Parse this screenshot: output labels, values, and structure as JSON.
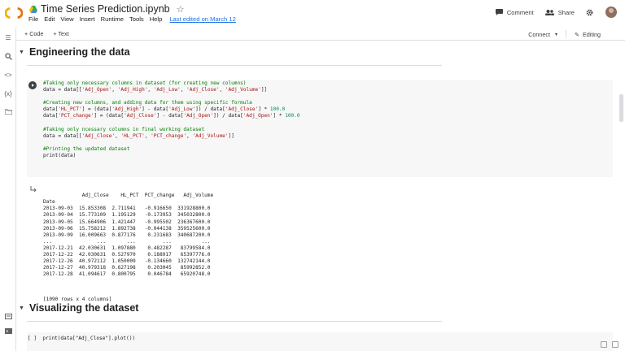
{
  "header": {
    "doc_title": "Time Series Prediction.ipynb",
    "menu": [
      "File",
      "Edit",
      "View",
      "Insert",
      "Runtime",
      "Tools",
      "Help"
    ],
    "last_edited": "Last edited on March 12",
    "comment_label": "Comment",
    "share_label": "Share"
  },
  "toolbar": {
    "code_label": "+ Code",
    "text_label": "+ Text",
    "connect_label": "Connect",
    "editing_label": "Editing"
  },
  "sections": {
    "engineering": "Engineering the data",
    "visualizing": "Visualizing the dataset"
  },
  "cell": {
    "code_lines": [
      "#Taking only necessary columns in dataset (for creating new columns)",
      "data = data[['Adj_Open', 'Adj_High', 'Adj_Low', 'Adj_Close', 'Adj_Volume']]",
      "",
      "#Creating new columns, and adding data for them using specific formula",
      "data['HL_PCT'] = (data['Adj_High'] - data['Adj_Low']) / data['Adj_Close'] * 100.0",
      "data['PCT_change'] = (data['Adj_Close'] - data['Adj_Open']) / data['Adj_Open'] * 100.0",
      "",
      "#Taking only ncessary columns in final working dataset",
      "data = data[['Adj_Close', 'HL_PCT', 'PCT_change', 'Adj_Volume']]",
      "",
      "#Printing the updated dataset",
      "print(data)"
    ],
    "output_lines": [
      "             Adj_Close    HL_PCT  PCT_change   Adj_Volume",
      "Date",
      "2013-09-03  15.853308  2.711941   -0.916650  331928800.0",
      "2013-09-04  15.773109  1.195129   -0.173953  345032800.0",
      "2013-09-05  15.664906  1.421447   -0.995502  236367600.0",
      "2013-09-06  15.758212  1.892738   -0.044138  359525600.0",
      "2013-09-09  16.009663  0.877176    0.231683  340687200.0",
      "...               ...       ...         ...          ...",
      "2017-12-21  42.030631  1.097880    0.482287   83799584.0",
      "2017-12-22  42.030631  0.527970    0.188917   65397776.0",
      "2017-12-26  40.972112  1.050009   -0.134660  132742144.0",
      "2017-12-27  40.979318  0.627198    0.203045   85992852.0",
      "2017-12-28  41.094617  0.800795    0.046784   65920748.0"
    ],
    "output_shape": "[1090 rows x 4 columns]"
  },
  "cell2": {
    "text": "[ ]  print(data[\"Adj_Close\"].plot())"
  }
}
